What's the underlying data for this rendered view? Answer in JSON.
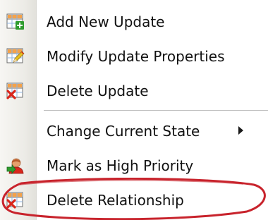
{
  "menu": {
    "items": [
      {
        "label": "Add New Update",
        "icon": "grid-add-icon"
      },
      {
        "label": "Modify Update Properties",
        "icon": "grid-edit-icon"
      },
      {
        "label": "Delete Update",
        "icon": "grid-delete-icon"
      },
      {
        "label": "Change Current State",
        "icon": null,
        "has_submenu": true
      },
      {
        "label": "Mark as High Priority",
        "icon": "user-priority-icon"
      },
      {
        "label": "Delete Relationship",
        "icon": "grid-delete-icon",
        "circled": true
      }
    ]
  },
  "colors": {
    "circle_annotation": "#c8232c",
    "grid_cell_orange": "#f4a24a",
    "grid_cell_blue": "#8fb4e0",
    "add_green": "#2e9c2e",
    "delete_red": "#d9261c",
    "edit_pencil": "#e8c020"
  }
}
